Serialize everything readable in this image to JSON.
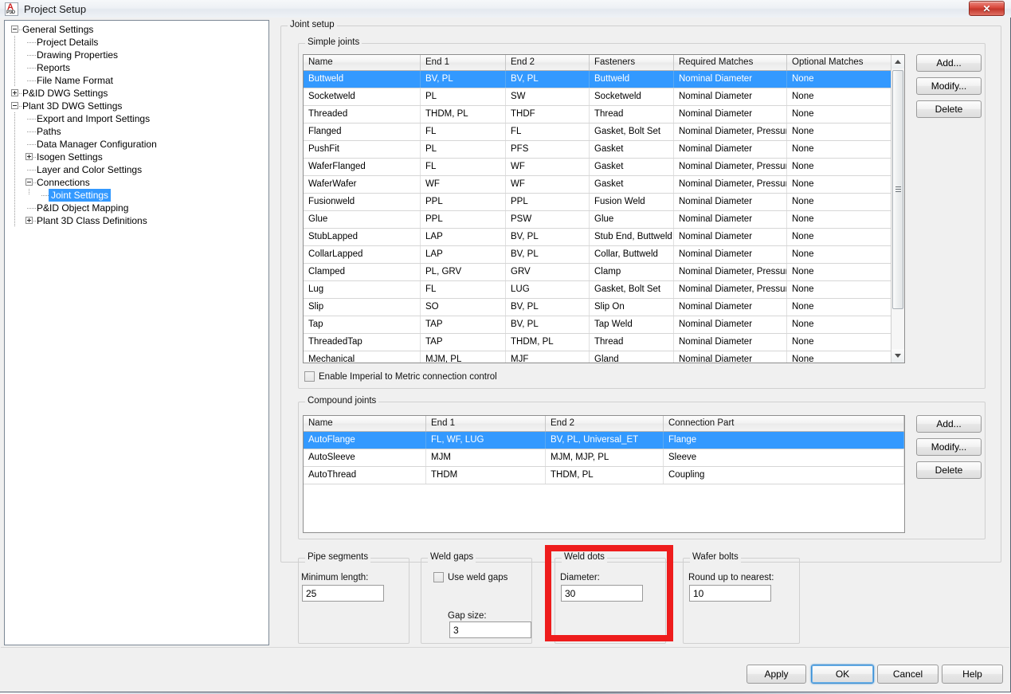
{
  "window": {
    "title": "Project Setup",
    "icon": "autocad-plant3d-icon",
    "icon_letter": "A",
    "icon_sub": "P3D",
    "close_label": "✕"
  },
  "tree": {
    "nodes": [
      {
        "label": "General Settings",
        "level": 0,
        "toggle": "minus",
        "selected": false
      },
      {
        "label": "Project Details",
        "level": 1,
        "toggle": "none",
        "selected": false
      },
      {
        "label": "Drawing Properties",
        "level": 1,
        "toggle": "none",
        "selected": false
      },
      {
        "label": "Reports",
        "level": 1,
        "toggle": "none",
        "selected": false
      },
      {
        "label": "File Name Format",
        "level": 1,
        "toggle": "none",
        "selected": false
      },
      {
        "label": "P&ID DWG Settings",
        "level": 0,
        "toggle": "plus",
        "selected": false
      },
      {
        "label": "Plant 3D DWG Settings",
        "level": 0,
        "toggle": "minus",
        "selected": false
      },
      {
        "label": "Export and Import Settings",
        "level": 1,
        "toggle": "none",
        "selected": false
      },
      {
        "label": "Paths",
        "level": 1,
        "toggle": "none",
        "selected": false
      },
      {
        "label": "Data Manager Configuration",
        "level": 1,
        "toggle": "none",
        "selected": false
      },
      {
        "label": "Isogen Settings",
        "level": 1,
        "toggle": "plus",
        "selected": false
      },
      {
        "label": "Layer and Color Settings",
        "level": 1,
        "toggle": "none",
        "selected": false
      },
      {
        "label": "Connections",
        "level": 1,
        "toggle": "minus",
        "selected": false
      },
      {
        "label": "Joint Settings",
        "level": 2,
        "toggle": "none",
        "selected": true
      },
      {
        "label": "P&ID Object Mapping",
        "level": 1,
        "toggle": "none",
        "selected": false
      },
      {
        "label": "Plant 3D Class Definitions",
        "level": 1,
        "toggle": "plus",
        "selected": false
      }
    ]
  },
  "page": {
    "header": "Joint setup"
  },
  "simple_joints": {
    "title": "Simple joints",
    "columns": [
      "Name",
      "End 1",
      "End 2",
      "Fasteners",
      "Required Matches",
      "Optional Matches"
    ],
    "rows": [
      {
        "cells": [
          "Buttweld",
          "BV, PL",
          "BV, PL",
          "Buttweld",
          "Nominal Diameter",
          "None"
        ],
        "selected": true
      },
      {
        "cells": [
          "Socketweld",
          "PL",
          "SW",
          "Socketweld",
          "Nominal Diameter",
          "None"
        ],
        "selected": false
      },
      {
        "cells": [
          "Threaded",
          "THDM, PL",
          "THDF",
          "Thread",
          "Nominal Diameter",
          "None"
        ],
        "selected": false
      },
      {
        "cells": [
          "Flanged",
          "FL",
          "FL",
          "Gasket, Bolt Set",
          "Nominal Diameter, Pressur...",
          "None"
        ],
        "selected": false
      },
      {
        "cells": [
          "PushFit",
          "PL",
          "PFS",
          "Gasket",
          "Nominal Diameter",
          "None"
        ],
        "selected": false
      },
      {
        "cells": [
          "WaferFlanged",
          "FL",
          "WF",
          "Gasket",
          "Nominal Diameter, Pressur...",
          "None"
        ],
        "selected": false
      },
      {
        "cells": [
          "WaferWafer",
          "WF",
          "WF",
          "Gasket",
          "Nominal Diameter, Pressur...",
          "None"
        ],
        "selected": false
      },
      {
        "cells": [
          "Fusionweld",
          "PPL",
          "PPL",
          "Fusion Weld",
          "Nominal Diameter",
          "None"
        ],
        "selected": false
      },
      {
        "cells": [
          "Glue",
          "PPL",
          "PSW",
          "Glue",
          "Nominal Diameter",
          "None"
        ],
        "selected": false
      },
      {
        "cells": [
          "StubLapped",
          "LAP",
          "BV, PL",
          "Stub End, Buttweld",
          "Nominal Diameter",
          "None"
        ],
        "selected": false
      },
      {
        "cells": [
          "CollarLapped",
          "LAP",
          "BV, PL",
          "Collar, Buttweld",
          "Nominal Diameter",
          "None"
        ],
        "selected": false
      },
      {
        "cells": [
          "Clamped",
          "PL, GRV",
          "GRV",
          "Clamp",
          "Nominal Diameter, Pressur...",
          "None"
        ],
        "selected": false
      },
      {
        "cells": [
          "Lug",
          "FL",
          "LUG",
          "Gasket, Bolt Set",
          "Nominal Diameter, Pressur...",
          "None"
        ],
        "selected": false
      },
      {
        "cells": [
          "Slip",
          "SO",
          "BV, PL",
          "Slip On",
          "Nominal Diameter",
          "None"
        ],
        "selected": false
      },
      {
        "cells": [
          "Tap",
          "TAP",
          "BV, PL",
          "Tap Weld",
          "Nominal Diameter",
          "None"
        ],
        "selected": false
      },
      {
        "cells": [
          "ThreadedTap",
          "TAP",
          "THDM, PL",
          "Thread",
          "Nominal Diameter",
          "None"
        ],
        "selected": false
      },
      {
        "cells": [
          "Mechanical",
          "MJM, PL",
          "MJF",
          "Gland",
          "Nominal Diameter",
          "None"
        ],
        "selected": false
      }
    ],
    "buttons": {
      "add": "Add...",
      "modify": "Modify...",
      "delete": "Delete"
    }
  },
  "imperial_metric": {
    "label": "Enable Imperial to Metric connection control",
    "checked": false
  },
  "compound_joints": {
    "title": "Compound joints",
    "columns": [
      "Name",
      "End 1",
      "End 2",
      "Connection Part"
    ],
    "rows": [
      {
        "cells": [
          "AutoFlange",
          "FL, WF, LUG",
          "BV, PL, Universal_ET",
          "Flange"
        ],
        "selected": true
      },
      {
        "cells": [
          "AutoSleeve",
          "MJM",
          "MJM, MJP, PL",
          "Sleeve"
        ],
        "selected": false
      },
      {
        "cells": [
          "AutoThread",
          "THDM",
          "THDM, PL",
          "Coupling"
        ],
        "selected": false
      }
    ],
    "buttons": {
      "add": "Add...",
      "modify": "Modify...",
      "delete": "Delete"
    }
  },
  "pipe_segments": {
    "title": "Pipe segments",
    "min_length_label": "Minimum length:",
    "min_length_value": "25"
  },
  "weld_gaps": {
    "title": "Weld gaps",
    "use_weld_gaps_label": "Use weld gaps",
    "use_weld_gaps_checked": false,
    "gap_size_label": "Gap size:",
    "gap_size_value": "3"
  },
  "weld_dots": {
    "title": "Weld dots",
    "diameter_label": "Diameter:",
    "diameter_value": "30",
    "highlight_color": "#ee1c1c"
  },
  "wafer_bolts": {
    "title": "Wafer bolts",
    "round_label": "Round up to nearest:",
    "round_value": "10"
  },
  "footer": {
    "apply": "Apply",
    "ok": "OK",
    "cancel": "Cancel",
    "help": "Help"
  },
  "colors": {
    "selection_blue": "#3399ff",
    "highlight_red": "#ee1c1c",
    "dialog_face": "#f0f0f0"
  }
}
